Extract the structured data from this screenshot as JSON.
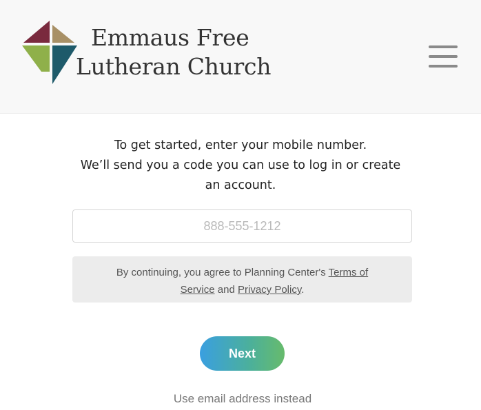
{
  "header": {
    "church_name_line1": "Emmaus Free",
    "church_name_line2": "Lutheran Church",
    "logo_icon": "cross-logo-icon",
    "menu_icon": "hamburger-menu-icon"
  },
  "intro": {
    "line1": "To get started, enter your mobile number.",
    "line2": "We’ll send you a code you can use to log in or create",
    "line3": "an account."
  },
  "phone": {
    "value": "",
    "placeholder": "888-555-1212"
  },
  "terms": {
    "prefix": "By continuing, you agree to Planning Center's ",
    "terms_link": "Terms of Service",
    "and_text": " and ",
    "privacy_link": "Privacy Policy",
    "suffix": "."
  },
  "actions": {
    "next_label": "Next",
    "alt_link": "Use email address instead"
  },
  "colors": {
    "logo_top_left": "#7a2a3e",
    "logo_top_right": "#a89066",
    "logo_bottom_left": "#8fb04a",
    "logo_bottom_right": "#1e5a6a",
    "button_gradient_start": "#3a9fe0",
    "button_gradient_end": "#67bb6c"
  }
}
